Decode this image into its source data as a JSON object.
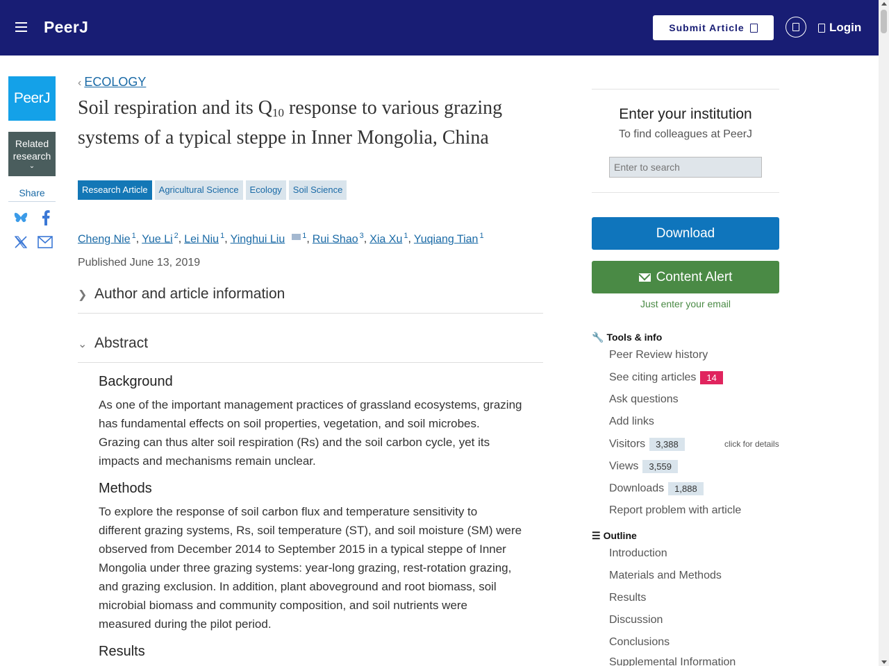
{
  "header": {
    "brand": "PeerJ",
    "submit_label": "Submit Article",
    "login_label": "Login"
  },
  "rail": {
    "logo_text": "PeerJ",
    "related_line1": "Related",
    "related_line2": "research",
    "share_label": "Share"
  },
  "article": {
    "breadcrumb": "ECOLOGY",
    "title_part1": "Soil respiration and its Q",
    "title_sub": "10",
    "title_part2": " response to various grazing systems of a typical steppe in Inner Mongolia, China",
    "tags": [
      "Research Article",
      "Agricultural Science",
      "Ecology",
      "Soil Science"
    ],
    "authors": [
      {
        "name": "Cheng Nie",
        "aff": "1"
      },
      {
        "name": "Yue Li",
        "aff": "2"
      },
      {
        "name": "Lei Niu",
        "aff": "1"
      },
      {
        "name": "Yinghui Liu",
        "aff": "1"
      },
      {
        "name": "Rui Shao",
        "aff": "3"
      },
      {
        "name": "Xia Xu",
        "aff": "1"
      },
      {
        "name": "Yuqiang Tian",
        "aff": "1"
      }
    ],
    "published": "Published June 13, 2019",
    "author_info_label": "Author and article information",
    "abstract_label": "Abstract",
    "background_h": "Background",
    "background_p": "As one of the important management practices of grassland ecosystems, grazing has fundamental effects on soil properties, vegetation, and soil microbes. Grazing can thus alter soil respiration (Rs) and the soil carbon cycle, yet its impacts and mechanisms remain unclear.",
    "methods_h": "Methods",
    "methods_p": "To explore the response of soil carbon flux and temperature sensitivity to different grazing systems, Rs, soil temperature (ST), and soil moisture (SM) were observed from December 2014 to September 2015 in a typical steppe of Inner Mongolia under three grazing systems: year-long grazing, rest-rotation grazing, and grazing exclusion. In addition, plant aboveground and root biomass, soil microbial biomass and community composition, and soil nutrients were measured during the pilot period.",
    "results_h": "Results"
  },
  "sidebar": {
    "institution_title": "Enter your institution",
    "institution_sub": "To find colleagues at PeerJ",
    "institution_placeholder": "Enter to search",
    "download_label": "Download",
    "alert_label": "Content Alert",
    "alert_note": "Just enter your email",
    "tools_heading": "Tools & info",
    "tools": {
      "peer_review": "Peer Review history",
      "citing": "See citing articles",
      "citing_count": "14",
      "ask": "Ask questions",
      "add_links": "Add links",
      "visitors": "Visitors",
      "visitors_count": "3,388",
      "click_details": "click for details",
      "views": "Views",
      "views_count": "3,559",
      "downloads": "Downloads",
      "downloads_count": "1,888",
      "report": "Report problem with article"
    },
    "outline_heading": "Outline",
    "outline": [
      "Introduction",
      "Materials and Methods",
      "Results",
      "Discussion",
      "Conclusions",
      "Supplemental Information"
    ]
  },
  "colors": {
    "header_bg": "#181d74",
    "link": "#1a6aa6",
    "download": "#0f75bc",
    "alert": "#4a8a45",
    "badge_red": "#e0245e"
  }
}
